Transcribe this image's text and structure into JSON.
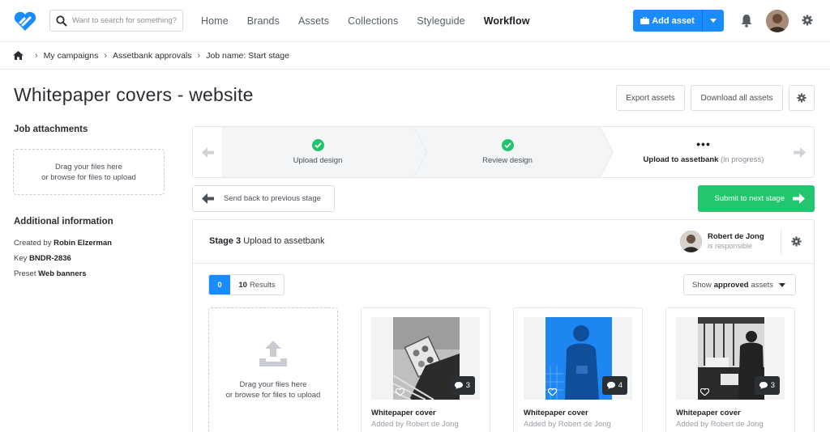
{
  "header": {
    "search_placeholder": "Want to search for something?",
    "nav": [
      "Home",
      "Brands",
      "Assets",
      "Collections",
      "Styleguide",
      "Workflow"
    ],
    "active_nav": "Workflow",
    "add_asset_label": "Add asset",
    "brand_color": "#1a8cff"
  },
  "breadcrumb": [
    "My campaigns",
    "Assetbank approvals",
    "Job name: Start stage"
  ],
  "page": {
    "title": "Whitepaper covers - website",
    "export_label": "Export assets",
    "download_label": "Download all assets"
  },
  "sidebar": {
    "attachments_title": "Job attachments",
    "drop_line1": "Drag your files here",
    "drop_line2": "or browse for files to upload",
    "info_title": "Additional information",
    "created_by_label": "Created by",
    "created_by_value": "Robin Elzerman",
    "key_label": "Key",
    "key_value": "BNDR-2836",
    "preset_label": "Preset",
    "preset_value": "Web banners"
  },
  "stepper": {
    "steps": [
      {
        "label": "Upload design",
        "status": "done"
      },
      {
        "label": "Review design",
        "status": "done"
      },
      {
        "label": "Upload to assetbank",
        "status": "current",
        "suffix": "(in progress)"
      }
    ],
    "done_color": "#1fc46b"
  },
  "actions": {
    "back_label": "Send back to previous stage",
    "submit_label": "Submit to next stage",
    "submit_color": "#22c66e"
  },
  "stage": {
    "stage_prefix": "Stage 3",
    "stage_name": "Upload to assetbank",
    "responsible_name": "Robert de Jong",
    "responsible_role": "is responsible",
    "count_selected": "0",
    "results_count": "10",
    "results_label": "Results",
    "filter_prefix": "Show",
    "filter_bold": "approved",
    "filter_suffix": "assets",
    "drop_line1": "Drag your files here",
    "drop_line2": "or browse for files to upload",
    "cards": [
      {
        "title": "Whitepaper cover",
        "subtitle": "Added by Robert de Jong",
        "comments": "3",
        "tone": "gray"
      },
      {
        "title": "Whitepaper cover",
        "subtitle": "Added by Robert de Jong",
        "comments": "4",
        "tone": "blue"
      },
      {
        "title": "Whitepaper cover",
        "subtitle": "Added by Robert de Jong",
        "comments": "3",
        "tone": "dark"
      }
    ]
  }
}
